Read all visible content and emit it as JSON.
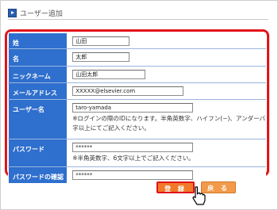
{
  "header": {
    "title": "ユーザー追加"
  },
  "form": {
    "last_name": {
      "label": "姓",
      "value": "山田"
    },
    "first_name": {
      "label": "名",
      "value": "太郎"
    },
    "nickname": {
      "label": "ニックネーム",
      "value": "山田太郎"
    },
    "email": {
      "label": "メールアドレス",
      "value": "XXXXX@elsevier.com"
    },
    "username": {
      "label": "ユーザー名",
      "value": "taro-yamada",
      "note_line1": "※ログインの際のIDになります。半角英数字、ハイフン(−)、アンダーバ",
      "note_line2": "字以上にてご記入ください。"
    },
    "password": {
      "label": "パスワード",
      "value": "******",
      "note": "※半角英数字、6文字以上でご記入ください。"
    },
    "password_confirm": {
      "label": "パスワードの確認",
      "value": "******"
    }
  },
  "buttons": {
    "register": "登 録",
    "back": "戻 る"
  },
  "colors": {
    "label_bg": "#2f6fcd",
    "highlight": "#e2131a",
    "button": "#f07a2a"
  },
  "icons": {
    "header": "bullet-arrow-icon",
    "pointer": "mouse-pointer-icon"
  }
}
